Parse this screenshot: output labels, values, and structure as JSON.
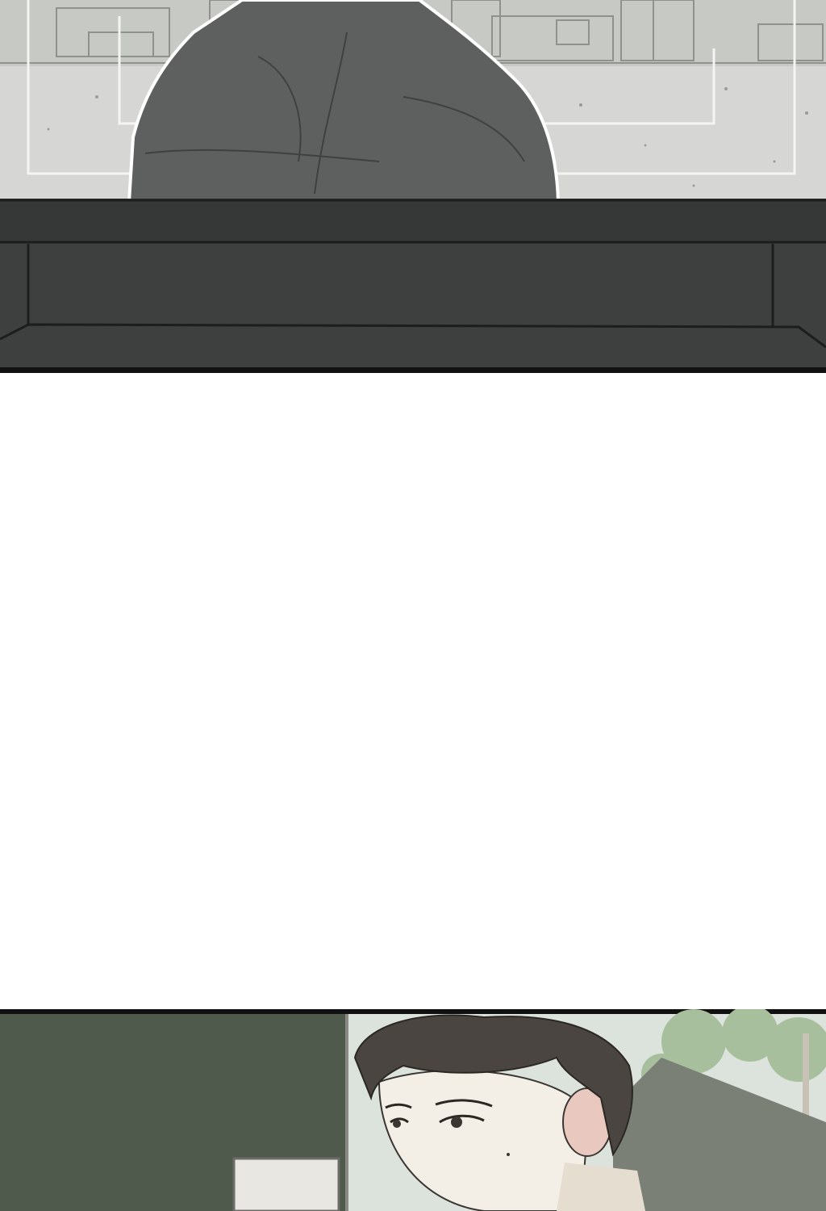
{
  "comic": {
    "panels": [
      {
        "id": "panel-1"
      },
      {
        "id": "panel-2"
      },
      {
        "id": "panel-3"
      }
    ],
    "colors": {
      "office_floor": "#d9d9d7",
      "jacket": "#5d5f5e",
      "desk": "#3a3d3b",
      "wall_green": "#4f5a4c",
      "wall_panel": "#9ea69b",
      "hair": "#4a4540",
      "skin": "#f4efe6",
      "ear": "#e8c7bd",
      "sky": "#dde6de",
      "tree": "#a9c09f",
      "bg_white": "#ffffff"
    }
  }
}
